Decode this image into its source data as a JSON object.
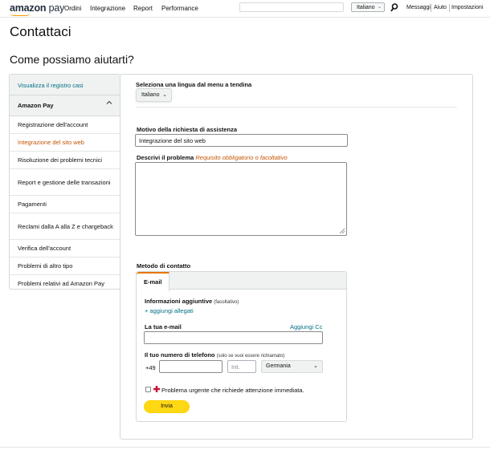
{
  "topnav": {
    "logo_main": "amazon",
    "logo_pay": "pay",
    "links": [
      "Ordini",
      "Integrazione",
      "Report",
      "Performance"
    ],
    "language": "Italiano",
    "right_links": [
      "Messaggi",
      "Aiuto",
      "Impostazioni"
    ]
  },
  "page_title": "Contattaci",
  "section_heading": "Come possiamo aiutarti?",
  "sidebar": {
    "top_link": "Visualizza il registro casi",
    "group": "Amazon Pay",
    "items": [
      {
        "label": "Registrazione dell'account",
        "active": false
      },
      {
        "label": "Integrazione del sito web",
        "active": true
      },
      {
        "label": "Risoluzione dei problemi tecnici",
        "active": false
      },
      {
        "label": "Report e gestione delle transazioni",
        "active": false
      },
      {
        "label": "Pagamenti",
        "active": false
      },
      {
        "label": "Reclami dalla A alla Z e chargeback",
        "active": false
      },
      {
        "label": "Verifica dell'account",
        "active": false
      },
      {
        "label": "Problemi di altro tipo",
        "active": false
      },
      {
        "label": "Problemi relativi ad Amazon Pay",
        "active": false
      }
    ]
  },
  "form": {
    "language_label": "Seleziona una lingua dal menu a tendina",
    "language_value": "Italiano",
    "reason_label": "Motivo della richiesta di assistenza",
    "reason_value": "Integrazione del sito web",
    "describe_label": "Descrivi il problema",
    "describe_hint": "Requisito obbligatorio o facoltativo",
    "describe_value": "",
    "contact_method_label": "Metodo di contatto",
    "tab_email": "E-mail",
    "extra_info_label": "Informazioni aggiuntive",
    "extra_info_optional": "(facoltativo)",
    "add_attachments": "+ aggiungi allegati",
    "your_email_label": "La tua e-mail",
    "add_cc": "Aggiungi Cc",
    "email_value": "",
    "phone_label": "Il tuo numero di telefono",
    "phone_hint": "(solo se vuoi essere richiamato)",
    "phone_prefix": "+49",
    "phone_value": "",
    "ext_placeholder": "Int.",
    "country_value": "Germania",
    "urgent_label": "Problema urgente che richiede attenzione immediata.",
    "urgent_checked": false,
    "send_label": "Invia"
  },
  "colors": {
    "link": "#007185",
    "active": "#c45500",
    "button": "#ffd814",
    "urgent_icon": "#cc0c39"
  }
}
